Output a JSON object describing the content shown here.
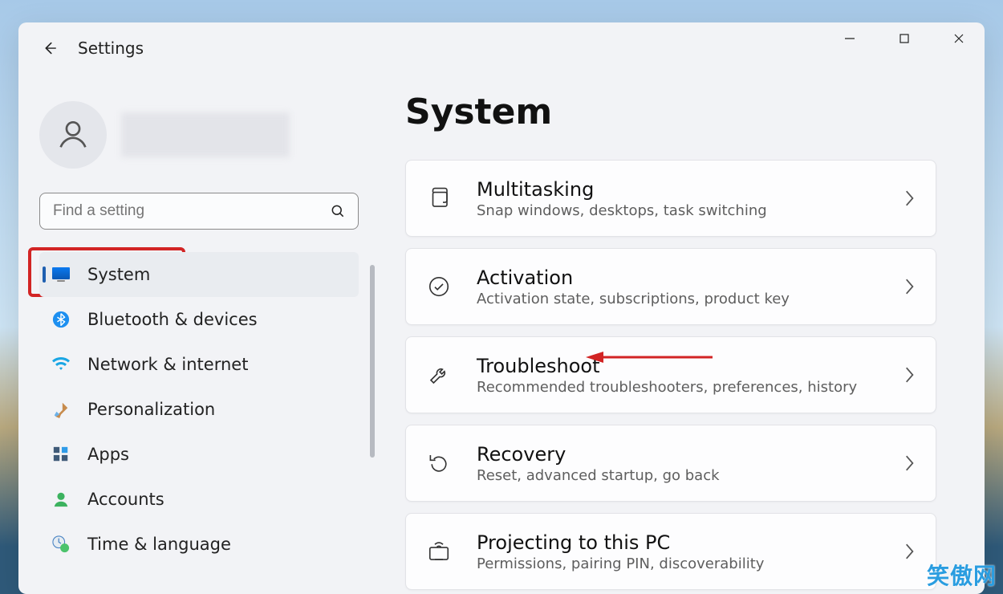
{
  "app": {
    "title": "Settings"
  },
  "search": {
    "placeholder": "Find a setting"
  },
  "nav": {
    "items": [
      {
        "key": "system",
        "label": "System"
      },
      {
        "key": "bluetooth",
        "label": "Bluetooth & devices"
      },
      {
        "key": "network",
        "label": "Network & internet"
      },
      {
        "key": "personalization",
        "label": "Personalization"
      },
      {
        "key": "apps",
        "label": "Apps"
      },
      {
        "key": "accounts",
        "label": "Accounts"
      },
      {
        "key": "time",
        "label": "Time & language"
      }
    ],
    "active_key": "system"
  },
  "page": {
    "title": "System",
    "cards": [
      {
        "key": "multitasking",
        "title": "Multitasking",
        "desc": "Snap windows, desktops, task switching"
      },
      {
        "key": "activation",
        "title": "Activation",
        "desc": "Activation state, subscriptions, product key"
      },
      {
        "key": "troubleshoot",
        "title": "Troubleshoot",
        "desc": "Recommended troubleshooters, preferences, history"
      },
      {
        "key": "recovery",
        "title": "Recovery",
        "desc": "Reset, advanced startup, go back"
      },
      {
        "key": "projecting",
        "title": "Projecting to this PC",
        "desc": "Permissions, pairing PIN, discoverability"
      }
    ]
  },
  "watermark": "笑傲网"
}
